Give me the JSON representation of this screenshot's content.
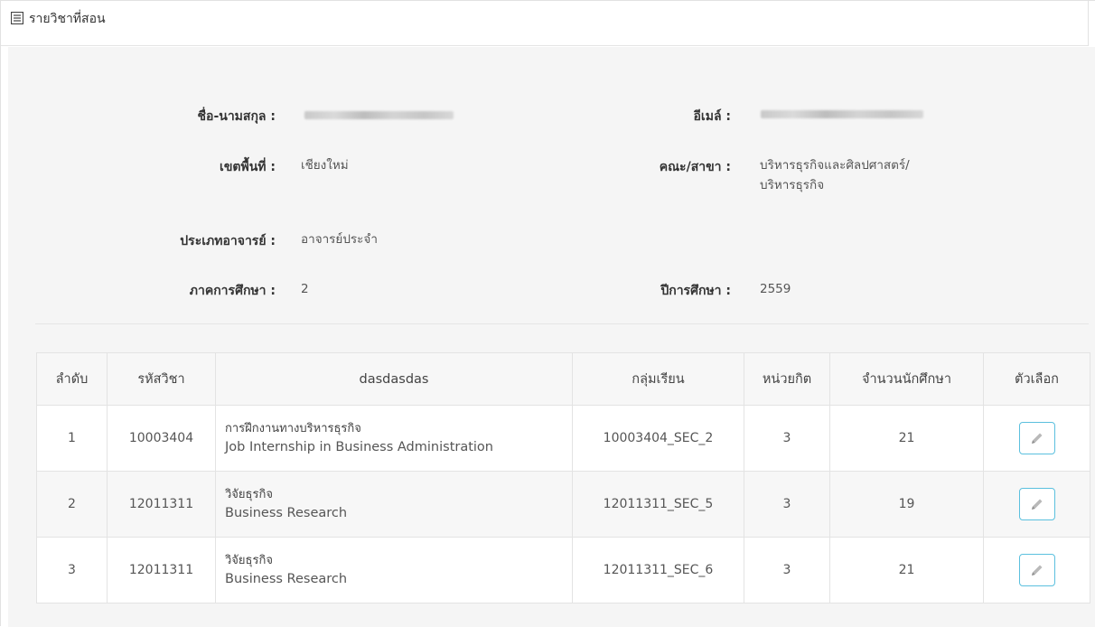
{
  "header": {
    "title": "รายวิชาที่สอน",
    "icon": "list-icon"
  },
  "info": {
    "name_label": "ชื่อ-นามสกุล :",
    "email_label": "อีเมล์ :",
    "area_label": "เขตพื้นที่ :",
    "area_value": "เชียงใหม่",
    "faculty_label": "คณะ/สาขา :",
    "faculty_value_line1": "บริหารธุรกิจและศิลปศาสตร์/",
    "faculty_value_line2": "บริหารธุรกิจ",
    "type_label": "ประเภทอาจารย์ :",
    "type_value": "อาจารย์ประจำ",
    "semester_label": "ภาคการศึกษา :",
    "semester_value": "2",
    "year_label": "ปีการศึกษา :",
    "year_value": "2559"
  },
  "table": {
    "headers": [
      "ลำดับ",
      "รหัสวิชา",
      "dasdasdas",
      "กลุ่มเรียน",
      "หน่วยกิต",
      "จำนวนนักศึกษา",
      "ตัวเลือก"
    ],
    "rows": [
      {
        "no": "1",
        "code": "10003404",
        "name_th": "การฝึกงานทางบริหารธุรกิจ",
        "name_en": "Job Internship in Business Administration",
        "section": "10003404_SEC_2",
        "credits": "3",
        "students": "21"
      },
      {
        "no": "2",
        "code": "12011311",
        "name_th": "วิจัยธุรกิจ",
        "name_en": "Business Research",
        "section": "12011311_SEC_5",
        "credits": "3",
        "students": "19"
      },
      {
        "no": "3",
        "code": "12011311",
        "name_th": "วิจัยธุรกิจ",
        "name_en": "Business Research",
        "section": "12011311_SEC_6",
        "credits": "3",
        "students": "21"
      }
    ],
    "edit_icon": "pencil-icon"
  },
  "colors": {
    "accent": "#5bc0de",
    "body_bg": "#f5f5f5"
  }
}
